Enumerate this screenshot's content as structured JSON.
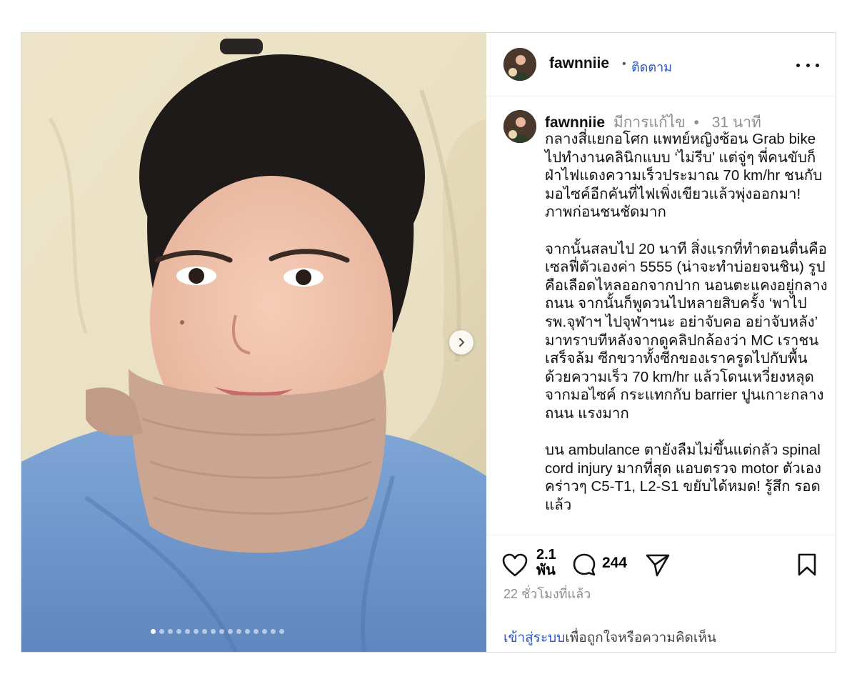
{
  "post": {
    "username": "fawnniie",
    "follow_label": "ติดตาม",
    "header_dot": "•",
    "edited_label": "มีการแก้ไข",
    "meta_dot": "•",
    "age": "31 นาที",
    "caption_paragraphs": [
      "กลางสี่แยกอโศก แพทย์หญิงซ้อน Grab bike ไปทำงานคลินิกแบบ ‘ไม่รีบ’ แต่จู่ๆ พี่คนขับก็ฝ่าไฟแดงความเร็วประมาณ 70 km/hr ชนกับมอไซค์อีกคันที่ไฟเพิ่งเขียวแล้วพุ่งออกมา! ภาพก่อนชนชัดมาก",
      "จากนั้นสลบไป 20 นาที สิ่งแรกที่ทำตอนตื่นคือ เซลฟี่ตัวเองค่า 5555 (น่าจะทำบ่อยจนชิน) รูปคือเลือดไหลออกจากปาก นอนตะแคงอยู่กลางถนน จากนั้นก็พูดวนไปหลายสิบครั้ง ‘พาไปรพ.จุฬาฯ ไปจุฬาฯนะ อย่าจับคอ อย่าจับหลัง’ มาทราบทีหลังจากดูคลิปกล้องว่า MC เราชนเสร็จล้ม ซีกขวาทั้งซีกของเราครูดไปกับพื้นด้วยความเร็ว 70 km/hr แล้วโดนเหวี่ยงหลุดจากมอไซค์ กระแทกกับ barrier ปูนเกาะกลางถนน แรงมาก",
      "บน ambulance ตายังลืมไม่ขึ้นแต่กลัว spinal cord injury มากที่สุด แอบตรวจ motor ตัวเองคร่าวๆ C5-T1, L2-S1 ขยับได้หมด! รู้สึก รอดแล้ว"
    ],
    "likes": "2.1\nพัน",
    "comments": "244",
    "time_ago": "22 ชั่วโมงที่แล้ว",
    "login_link": "เข้าสู่ระบบ",
    "login_suffix": "เพื่อถูกใจหรือความคิดเห็น"
  },
  "carousel": {
    "total": 16,
    "active_index": 0
  },
  "icons": {
    "more": "more-options-icon",
    "next": "chevron-right-icon",
    "like": "heart-icon",
    "comment": "comment-bubble-icon",
    "share": "paper-plane-icon",
    "save": "bookmark-icon"
  },
  "colors": {
    "link": "#2a56c6",
    "muted": "#8e8e8e",
    "border": "#dbdbdb"
  }
}
